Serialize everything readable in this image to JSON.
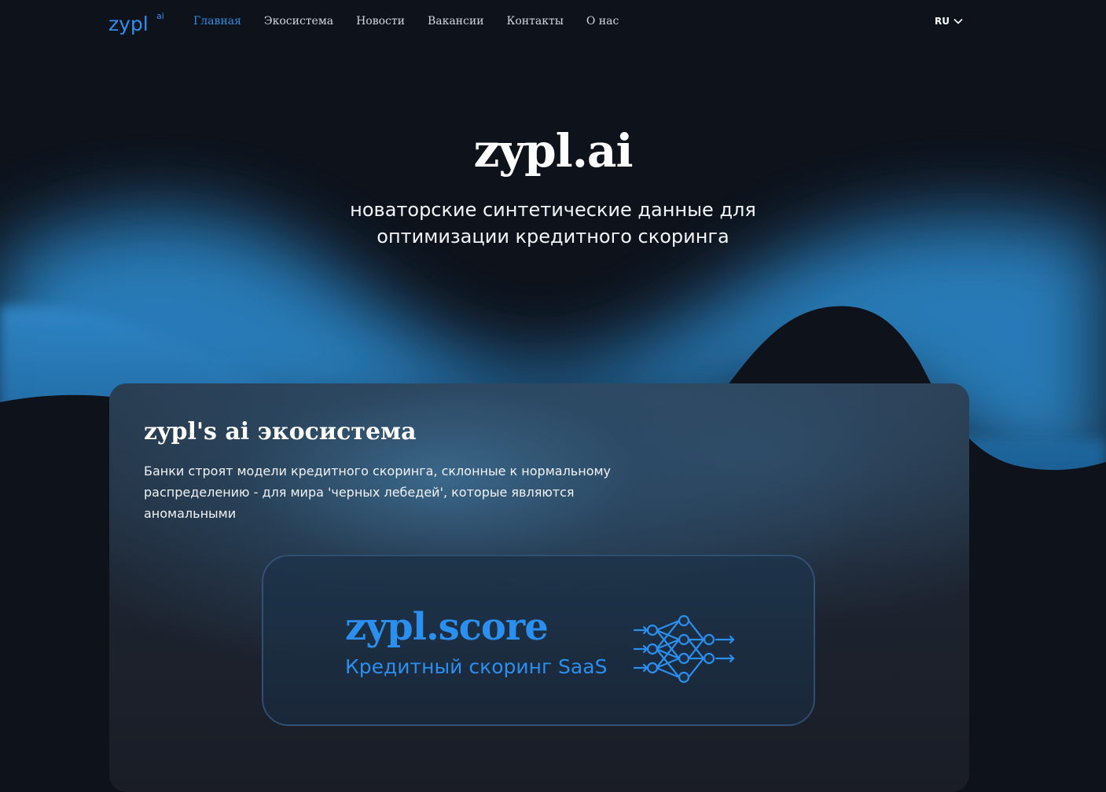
{
  "header": {
    "logo_text": "zypl",
    "logo_sup": "ai",
    "nav": [
      {
        "label": "Главная",
        "active": true
      },
      {
        "label": "Экосистема",
        "active": false
      },
      {
        "label": "Новости",
        "active": false
      },
      {
        "label": "Вакансии",
        "active": false
      },
      {
        "label": "Контакты",
        "active": false
      },
      {
        "label": "О нас",
        "active": false
      }
    ],
    "language": "RU"
  },
  "hero": {
    "title": "zypl.ai",
    "subtitle_line1": "новаторские синтетические данные для",
    "subtitle_line2": "оптимизации кредитного скоринга"
  },
  "ecosystem": {
    "title": "zypl's ai экосистема",
    "description": "Банки строят модели кредитного скоринга, склонные к нормальному распределению - для мира 'черных лебедей', которые являются аномальными",
    "product": {
      "name": "zypl.score",
      "subtitle": "Кредитный скоринг SaaS",
      "icon": "neural-network-icon"
    }
  },
  "colors": {
    "accent": "#2b8ff0",
    "nav_active": "#2f8de4",
    "background": "#0e121b",
    "wave_blue": "#2a7fc0"
  }
}
